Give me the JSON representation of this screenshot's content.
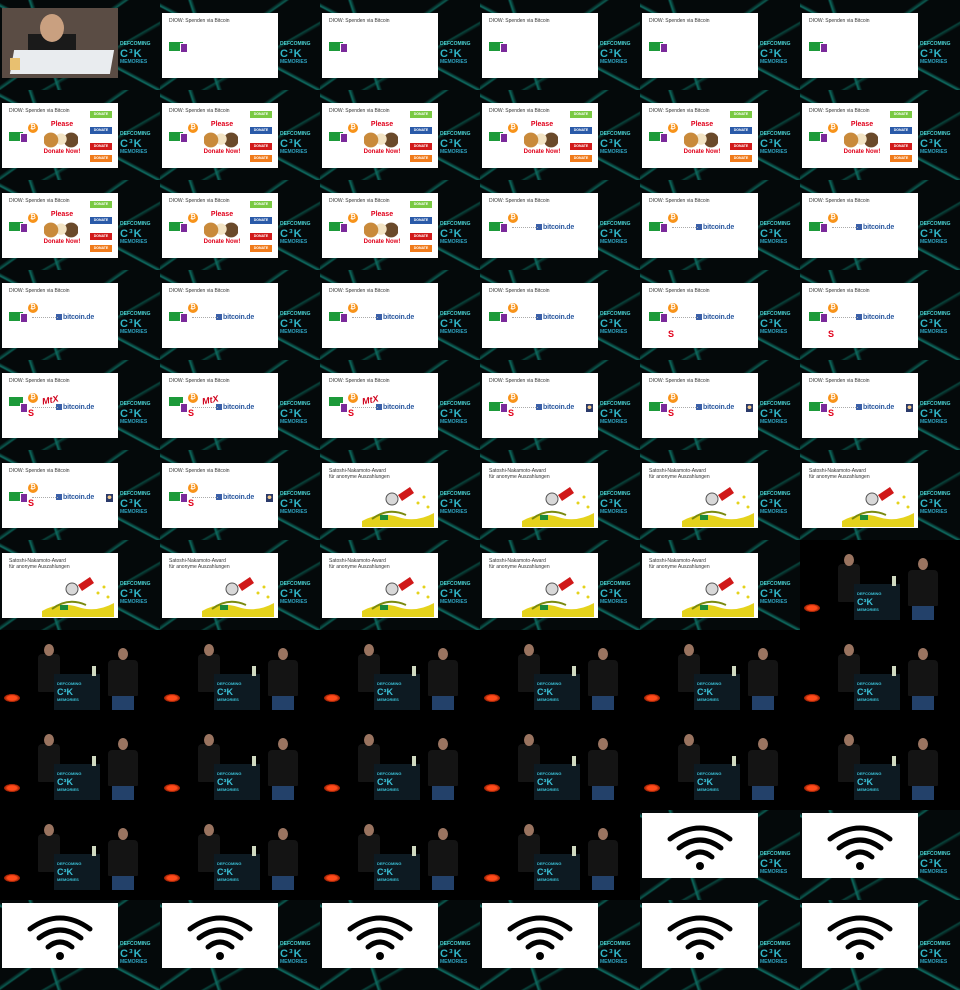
{
  "grid": {
    "columns": 6,
    "rows": 11
  },
  "slide_titles": {
    "spenden": "DIOW: Spenden via Bitcoin",
    "award_line1": "Satoshi-Nakamoto-Award",
    "award_line2": "für anonyme Auszahlungen"
  },
  "labels": {
    "please": "Please",
    "donate_now": "Donate Now!",
    "donate_btn": "DONATE",
    "bitcoin_de": "bitcoin.de",
    "mtx": "MtX",
    "btc_symbol": "₿",
    "sparkasse": "S",
    "logo_line1": "DEFCOMING",
    "logo_big": "C³K",
    "logo_line3": "MEMORIES"
  },
  "colors": {
    "bitcoin": "#f7931a",
    "teal_network": "#0e6e64",
    "donate_red": "#e0001a"
  },
  "frames": [
    "intro",
    "empty",
    "empty",
    "empty",
    "empty",
    "empty",
    "dogs",
    "dogs",
    "dogs",
    "dogs",
    "dogs",
    "dogs",
    "dogs",
    "dogs",
    "dogs",
    "bcde",
    "bcde",
    "bcde",
    "bcde",
    "bcde",
    "bcde",
    "bcde",
    "bcde_s",
    "bcde_s",
    "mtx",
    "mtx",
    "mtx",
    "ninja",
    "ninja",
    "ninja",
    "ninja",
    "ninja",
    "award",
    "award",
    "award",
    "award",
    "award",
    "award",
    "award",
    "award",
    "award",
    "stage",
    "stage",
    "stage",
    "stage",
    "stage",
    "stage",
    "stage",
    "stage",
    "stage",
    "stage",
    "stage",
    "stage",
    "stage",
    "stage",
    "stage",
    "stage",
    "stage",
    "wifi",
    "wifi",
    "wifi",
    "wifi",
    "wifi",
    "wifi",
    "wifi",
    "wifi"
  ]
}
